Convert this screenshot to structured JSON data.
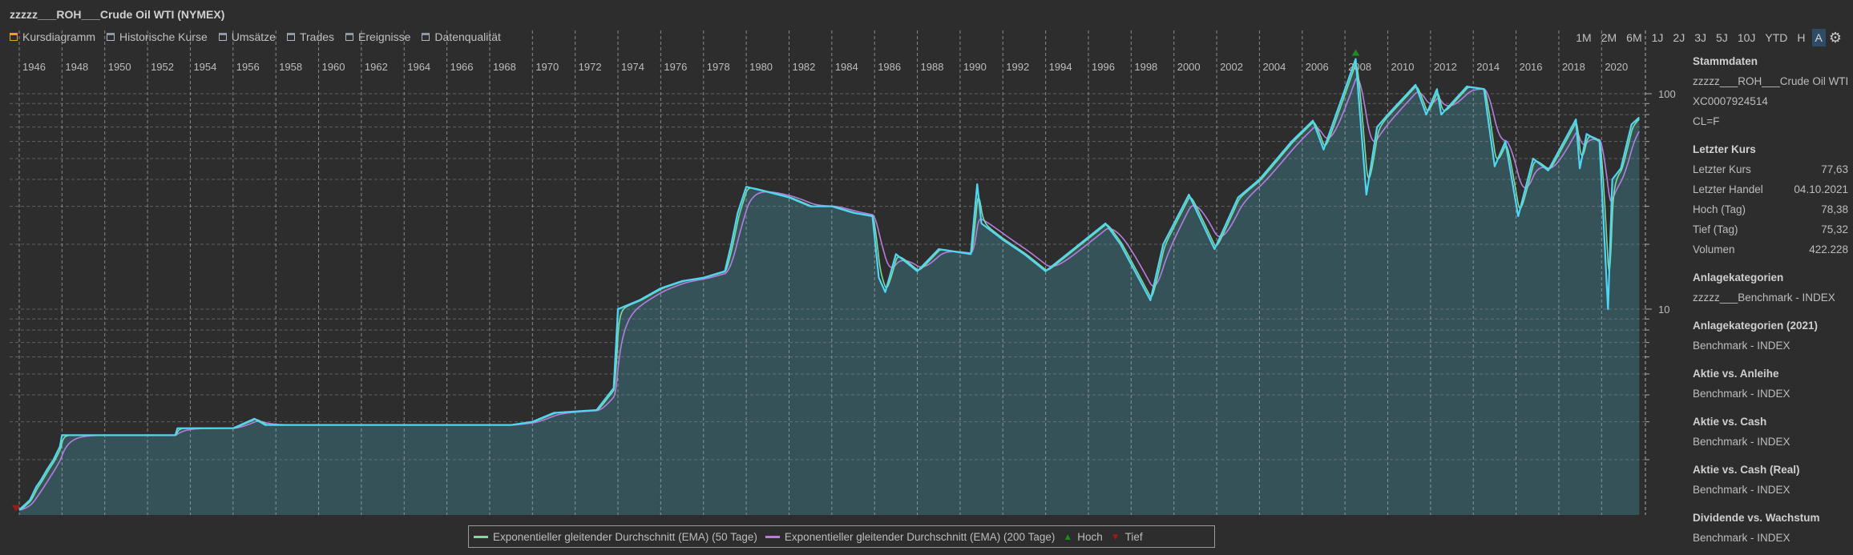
{
  "window": {
    "title": "zzzzz___ROH___Crude Oil WTI (NYMEX)"
  },
  "tabs": [
    {
      "label": "Kursdiagramm",
      "active": true
    },
    {
      "label": "Historische Kurse",
      "active": false
    },
    {
      "label": "Umsätze",
      "active": false
    },
    {
      "label": "Trades",
      "active": false
    },
    {
      "label": "Ereignisse",
      "active": false
    },
    {
      "label": "Datenqualität",
      "active": false
    }
  ],
  "periods": [
    "1M",
    "2M",
    "6M",
    "1J",
    "2J",
    "3J",
    "5J",
    "10J",
    "YTD",
    "H",
    "A"
  ],
  "active_period": "A",
  "sidebar": {
    "sections": [
      {
        "title": "Stammdaten",
        "rows": [
          {
            "label": "zzzzz___ROH___Crude Oil WTI",
            "value": ""
          },
          {
            "label": "XC0007924514",
            "value": ""
          },
          {
            "label": "CL=F",
            "value": ""
          }
        ]
      },
      {
        "title": "Letzter Kurs",
        "rows": [
          {
            "label": "Letzter Kurs",
            "value": "77,63"
          },
          {
            "label": "Letzter Handel",
            "value": "04.10.2021"
          },
          {
            "label": "Hoch (Tag)",
            "value": "78,38"
          },
          {
            "label": "Tief (Tag)",
            "value": "75,32"
          },
          {
            "label": "Volumen",
            "value": "422.228"
          }
        ]
      },
      {
        "title": "Anlagekategorien",
        "rows": [
          {
            "label": "zzzzz___Benchmark - INDEX",
            "value": ""
          }
        ]
      },
      {
        "title": "Anlagekategorien (2021)",
        "rows": [
          {
            "label": "Benchmark - INDEX",
            "value": ""
          }
        ]
      },
      {
        "title": "Aktie vs. Anleihe",
        "rows": [
          {
            "label": "Benchmark - INDEX",
            "value": ""
          }
        ]
      },
      {
        "title": "Aktie vs. Cash",
        "rows": [
          {
            "label": "Benchmark - INDEX",
            "value": ""
          }
        ]
      },
      {
        "title": "Aktie vs. Cash (Real)",
        "rows": [
          {
            "label": "Benchmark - INDEX",
            "value": ""
          }
        ]
      },
      {
        "title": "Dividende vs. Wachstum",
        "rows": [
          {
            "label": "Benchmark - INDEX",
            "value": ""
          }
        ]
      }
    ]
  },
  "legend": {
    "ema50": "Exponentieller gleitender Durchschnitt (EMA) (50 Tage)",
    "ema200": "Exponentieller gleitender Durchschnitt (EMA) (200 Tage)",
    "high": "Hoch",
    "low": "Tief"
  },
  "colors": {
    "price": "#4fd6f4",
    "area": "#355258",
    "ema50": "#7fd8a0",
    "ema200": "#b47ee0",
    "high": "#1e8a1e",
    "low": "#a01818",
    "grid": "#8a8a8a"
  },
  "chart_data": {
    "type": "line",
    "scale": "log",
    "x_ticks": [
      1946,
      1948,
      1950,
      1952,
      1954,
      1956,
      1958,
      1960,
      1962,
      1964,
      1966,
      1968,
      1970,
      1972,
      1974,
      1976,
      1978,
      1980,
      1982,
      1984,
      1986,
      1988,
      1990,
      1992,
      1994,
      1996,
      1998,
      2000,
      2002,
      2004,
      2006,
      2008,
      2010,
      2012,
      2014,
      2016,
      2018,
      2020
    ],
    "y_ticks": [
      10,
      100
    ],
    "xlim": [
      1945.8,
      2021.9
    ],
    "ylim": [
      1.1,
      160
    ],
    "series_name": "Crude Oil WTI",
    "price": [
      [
        1946.0,
        1.17
      ],
      [
        1946.5,
        1.3
      ],
      [
        1946.8,
        1.5
      ],
      [
        1947.0,
        1.6
      ],
      [
        1947.3,
        1.8
      ],
      [
        1947.6,
        2.0
      ],
      [
        1947.9,
        2.3
      ],
      [
        1948.0,
        2.6
      ],
      [
        1953.3,
        2.6
      ],
      [
        1953.4,
        2.8
      ],
      [
        1956.0,
        2.8
      ],
      [
        1957.0,
        3.1
      ],
      [
        1957.5,
        2.9
      ],
      [
        1959,
        2.9
      ],
      [
        1965,
        2.9
      ],
      [
        1969,
        2.9
      ],
      [
        1970,
        3.0
      ],
      [
        1971,
        3.3
      ],
      [
        1973,
        3.4
      ],
      [
        1973.8,
        4.3
      ],
      [
        1974.0,
        10
      ],
      [
        1975,
        11
      ],
      [
        1976,
        12.5
      ],
      [
        1977,
        13.5
      ],
      [
        1978,
        14
      ],
      [
        1979.0,
        15
      ],
      [
        1979.3,
        20
      ],
      [
        1979.6,
        28
      ],
      [
        1980,
        37
      ],
      [
        1981,
        35
      ],
      [
        1982,
        33
      ],
      [
        1983,
        30
      ],
      [
        1984,
        30
      ],
      [
        1985,
        28
      ],
      [
        1985.9,
        27
      ],
      [
        1986.2,
        14
      ],
      [
        1986.5,
        12
      ],
      [
        1987,
        18
      ],
      [
        1988,
        15
      ],
      [
        1989,
        19
      ],
      [
        1990.5,
        18
      ],
      [
        1990.8,
        38
      ],
      [
        1991.0,
        25
      ],
      [
        1992,
        21
      ],
      [
        1993,
        18
      ],
      [
        1994.0,
        15
      ],
      [
        1995,
        18
      ],
      [
        1996.8,
        25
      ],
      [
        1997.5,
        20
      ],
      [
        1998.9,
        11
      ],
      [
        1999.5,
        20
      ],
      [
        2000.7,
        34
      ],
      [
        2001.9,
        19
      ],
      [
        2003.0,
        33
      ],
      [
        2004,
        40
      ],
      [
        2005.5,
        60
      ],
      [
        2006.5,
        75
      ],
      [
        2007.0,
        55
      ],
      [
        2008.5,
        145
      ],
      [
        2009.0,
        34
      ],
      [
        2009.5,
        70
      ],
      [
        2010,
        80
      ],
      [
        2011.3,
        110
      ],
      [
        2011.8,
        80
      ],
      [
        2012.3,
        105
      ],
      [
        2012.5,
        80
      ],
      [
        2013.7,
        108
      ],
      [
        2014.5,
        105
      ],
      [
        2015.0,
        46
      ],
      [
        2015.5,
        60
      ],
      [
        2016.1,
        27
      ],
      [
        2016.8,
        50
      ],
      [
        2017.5,
        44
      ],
      [
        2018.8,
        76
      ],
      [
        2018.98,
        45
      ],
      [
        2019.3,
        65
      ],
      [
        2019.9,
        60
      ],
      [
        2020.3,
        10
      ],
      [
        2020.5,
        40
      ],
      [
        2020.9,
        45
      ],
      [
        2021.4,
        72
      ],
      [
        2021.76,
        77.63
      ]
    ],
    "high_marker": {
      "x": 2008.5,
      "y": 145
    },
    "low_marker": {
      "x": 1946.0,
      "y": 1.17
    }
  }
}
